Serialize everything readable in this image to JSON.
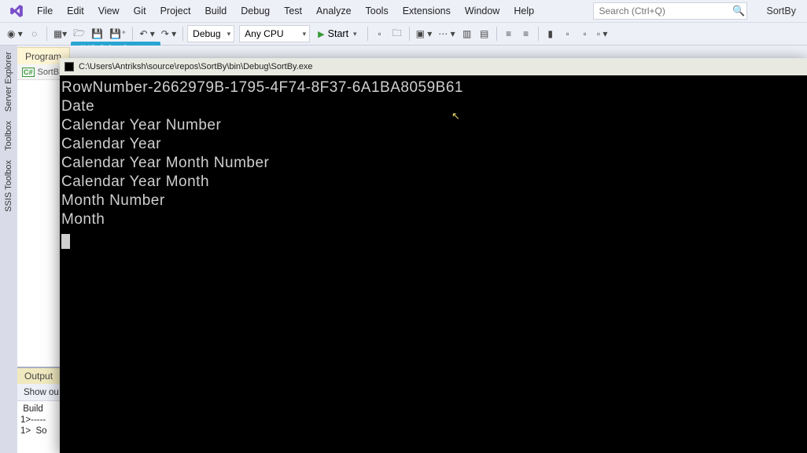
{
  "menu": {
    "items": [
      "File",
      "Edit",
      "View",
      "Git",
      "Project",
      "Build",
      "Debug",
      "Test",
      "Analyze",
      "Tools",
      "Extensions",
      "Window",
      "Help"
    ]
  },
  "search_placeholder": "Search (Ctrl+Q)",
  "solution_name": "SortBy",
  "toolbar": {
    "config_combo": "Debug",
    "platform_combo": "Any CPU",
    "start_label": "Start"
  },
  "cyber_tag": "AVG CyberCapture",
  "side_tabs": [
    "Server Explorer",
    "Toolbox",
    "SSIS Toolbox"
  ],
  "doc_tabs": [
    "Program"
  ],
  "editor_strip_label": "SortB",
  "output": {
    "tab": "Output",
    "bar": "Show ou",
    "lines": [
      " Build ",
      "1>-----",
      "1>  So",
      ""
    ]
  },
  "console": {
    "title": "C:\\Users\\Antriksh\\source\\repos\\SortBy\\bin\\Debug\\SortBy.exe",
    "lines": [
      "RowNumber-2662979B-1795-4F74-8F37-6A1BA8059B61",
      "Date",
      "Calendar Year Number",
      "Calendar Year",
      "Calendar Year Month Number",
      "Calendar Year Month",
      "Month Number",
      "Month"
    ]
  }
}
